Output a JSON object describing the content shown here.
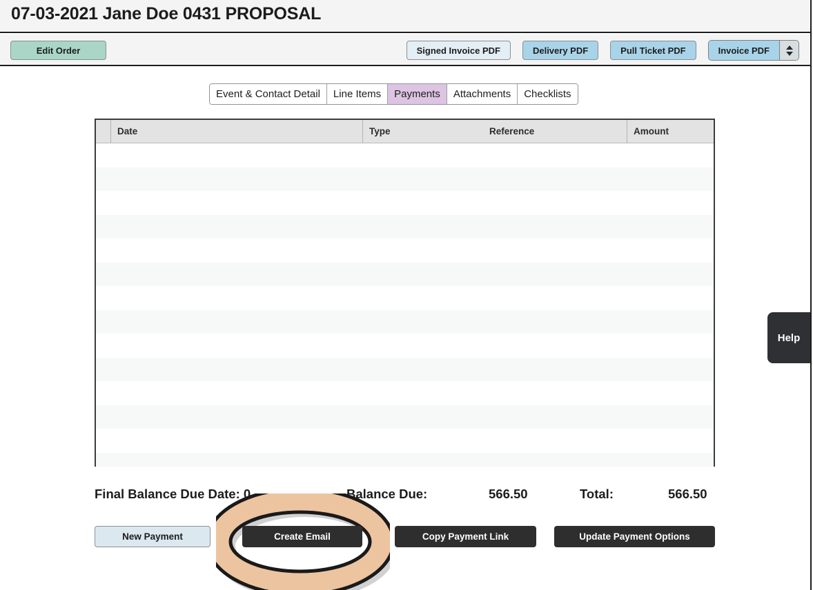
{
  "header": {
    "title": "07-03-2021 Jane Doe 0431 PROPOSAL"
  },
  "toolbar": {
    "edit_order_label": "Edit Order",
    "pdf_buttons": [
      {
        "label": "Signed Invoice PDF",
        "color": "#e3eef5"
      },
      {
        "label": "Delivery PDF",
        "color": "#a9d3e8"
      },
      {
        "label": "Pull Ticket PDF",
        "color": "#a9d3e8"
      }
    ],
    "invoice_pdf_label": "Invoice PDF",
    "stepper_up_icon": "triangle-up-icon",
    "stepper_down_icon": "triangle-down-icon"
  },
  "tabs": [
    {
      "label": "Event & Contact Detail",
      "active": false
    },
    {
      "label": "Line Items",
      "active": false
    },
    {
      "label": "Payments",
      "active": true
    },
    {
      "label": "Attachments",
      "active": false
    },
    {
      "label": "Checklists",
      "active": false
    }
  ],
  "table": {
    "columns": [
      "",
      "Date",
      "Type",
      "Reference",
      "Amount"
    ],
    "rows": [],
    "empty_row_count": 14
  },
  "summary": {
    "final_balance_due_date_label": "Final Balance Due Date: 0",
    "balance_due_label": "Balance Due:",
    "balance_due_value": "566.50",
    "total_label": "Total:",
    "total_value": "566.50"
  },
  "actions": {
    "new_payment_label": "New Payment",
    "create_email_label": "Create Email",
    "copy_payment_link_label": "Copy Payment Link",
    "update_payment_options_label": "Update Payment Options"
  },
  "help": {
    "label": "Help"
  },
  "highlight": {
    "target": "create-email-button",
    "ring_color": "#edc4a0",
    "outline_color": "#1a1a1a",
    "shadow_color": "#c9c9c9"
  },
  "theme": {
    "accent_green": "#a9d6c7",
    "accent_blue": "#a9d3e8",
    "accent_purple": "#dcc4e2",
    "dark_button": "#2e2e2e"
  }
}
